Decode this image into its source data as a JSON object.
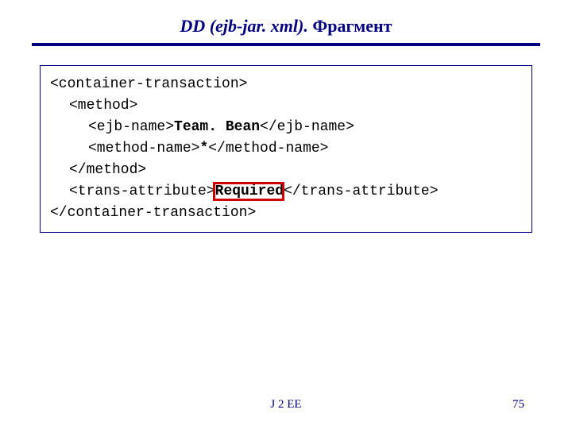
{
  "slide": {
    "title_italic": "DD (ejb-jar. xml). ",
    "title_plain": "Фрагмент"
  },
  "code": {
    "l1": "<container-transaction>",
    "l2": "<method>",
    "l3a": "<ejb-name>",
    "l3b": "Team. Bean",
    "l3c": "</ejb-name>",
    "l4a": "<method-name>",
    "l4b": "*",
    "l4c": "</method-name>",
    "l5": "</method>",
    "l6a": "<trans-attribute>",
    "l6b": "Required",
    "l6c": "</trans-attribute>",
    "l7": "</container-transaction>"
  },
  "highlight": {
    "target": "Required"
  },
  "footer": {
    "center": "J 2 EE",
    "page": "75"
  }
}
